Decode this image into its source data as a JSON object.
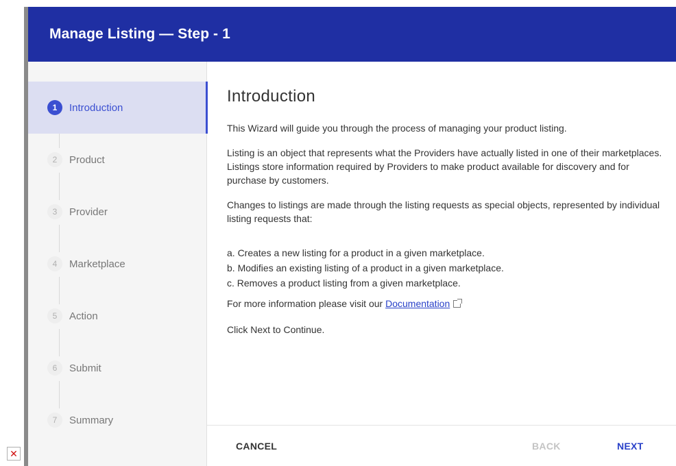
{
  "modal": {
    "title": "Manage Listing — Step - 1"
  },
  "steps": [
    {
      "number": "1",
      "label": "Introduction",
      "active": true
    },
    {
      "number": "2",
      "label": "Product"
    },
    {
      "number": "3",
      "label": "Provider"
    },
    {
      "number": "4",
      "label": "Marketplace"
    },
    {
      "number": "5",
      "label": "Action"
    },
    {
      "number": "6",
      "label": "Submit"
    },
    {
      "number": "7",
      "label": "Summary"
    }
  ],
  "content": {
    "heading": "Introduction",
    "paragraphs": [
      "This Wizard will guide you through the process of managing your product listing.",
      "Listing is an object that represents what the Providers have actually listed in one of their marketplaces. Listings store information required by Providers to make product available for discovery and for purchase by customers.",
      "Changes to listings are made through the listing requests as special objects, represented by individual listing requests that:"
    ],
    "list": [
      "a. Creates a new listing for a product in a given marketplace.",
      "b. Modifies an existing listing of a product in a given marketplace.",
      "c. Removes a product listing from a given marketplace."
    ],
    "more_info_prefix": "For more information please visit our ",
    "doc_link": "Documentation",
    "continue_text": "Click Next to Continue."
  },
  "footer": {
    "cancel": "CANCEL",
    "back": "BACK",
    "next": "NEXT"
  },
  "icons": {
    "external_link": "external-link-icon",
    "broken_image": "broken-image-icon"
  },
  "colors": {
    "header_bg": "#1f2fa3",
    "accent": "#3b4fd1",
    "link": "#2840c8",
    "active_step_bg": "#dcdef2"
  }
}
